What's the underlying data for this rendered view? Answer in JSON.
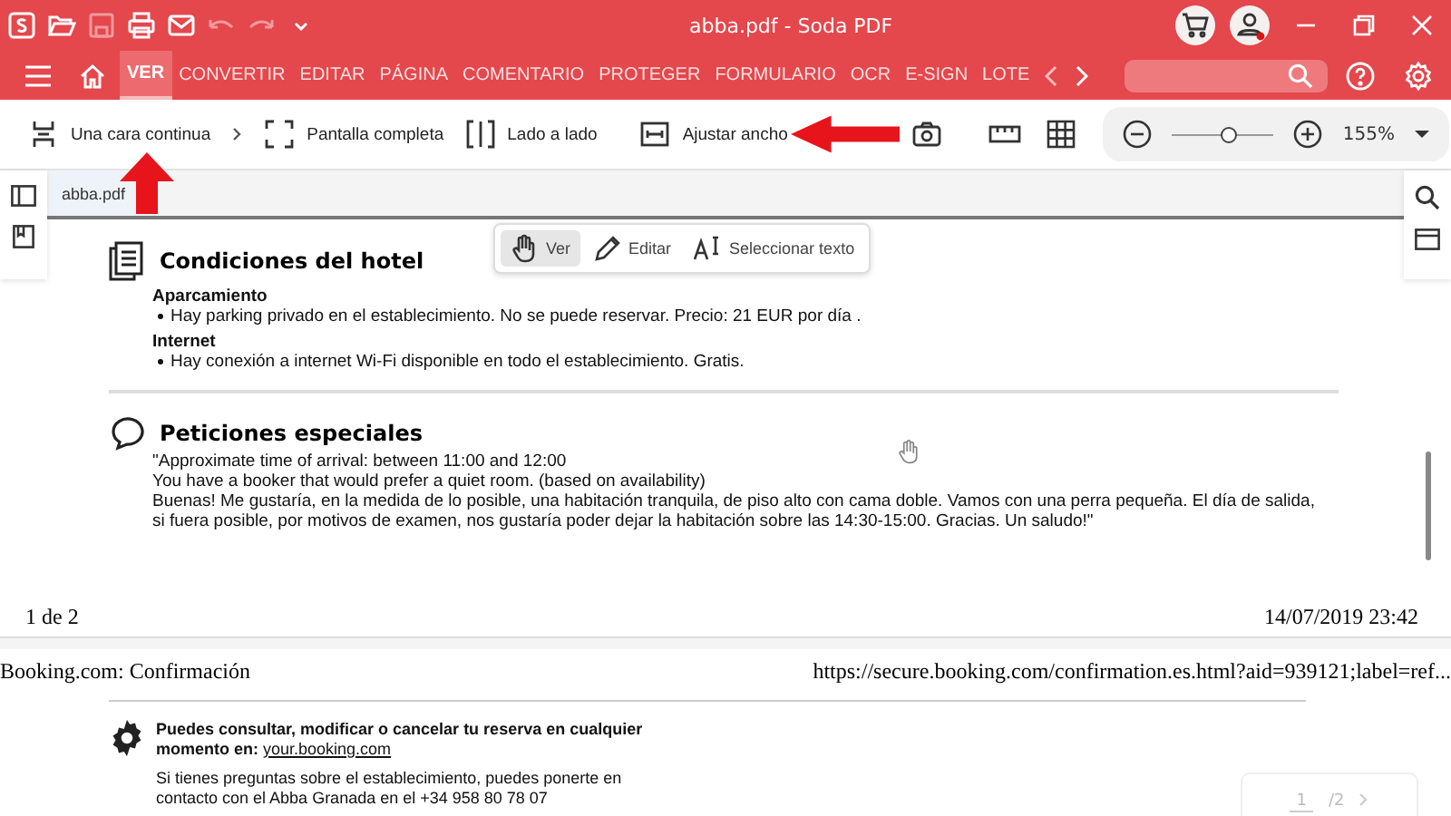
{
  "window": {
    "title": "abba.pdf  -  Soda PDF"
  },
  "quick_access": [
    {
      "kind": "logo",
      "disabled": false
    },
    {
      "kind": "open",
      "disabled": false
    },
    {
      "kind": "save",
      "disabled": true
    },
    {
      "kind": "print",
      "disabled": false
    },
    {
      "kind": "mail",
      "disabled": false
    },
    {
      "kind": "undo",
      "disabled": true
    },
    {
      "kind": "redo",
      "disabled": true
    },
    {
      "kind": "caret",
      "disabled": false
    }
  ],
  "menu_tabs": [
    {
      "label": "VER",
      "selected": true
    },
    {
      "label": "CONVERTIR",
      "selected": false
    },
    {
      "label": "EDITAR",
      "selected": false
    },
    {
      "label": "PÁGINA",
      "selected": false
    },
    {
      "label": "COMENTARIO",
      "selected": false
    },
    {
      "label": "PROTEGER",
      "selected": false
    },
    {
      "label": "FORMULARIO",
      "selected": false
    },
    {
      "label": "OCR",
      "selected": false
    },
    {
      "label": "E-SIGN",
      "selected": false
    },
    {
      "label": "LOTE",
      "selected": false
    }
  ],
  "toolbar": [
    {
      "kind": "continuous",
      "label": "Una cara continua"
    },
    {
      "kind": "fullscreen",
      "label": "Pantalla completa"
    },
    {
      "kind": "sidebyside",
      "label": "Lado a lado"
    },
    {
      "kind": "fitwidth",
      "label": "Ajustar ancho"
    }
  ],
  "zoom": {
    "level": 0.55,
    "reading": "155%"
  },
  "document_tab": {
    "label": "abba.pdf"
  },
  "view_modes": [
    {
      "kind": "hand",
      "label": "Ver",
      "selected": true
    },
    {
      "kind": "pen",
      "label": "Editar",
      "selected": false
    },
    {
      "kind": "text",
      "label": "Seleccionar texto",
      "selected": false
    }
  ],
  "page": {
    "sections": [
      {
        "kind": "doc",
        "title": "Condiciones del hotel",
        "items": [
          {
            "heading": "Aparcamiento",
            "bullets": [
              "Hay parking privado en el establecimiento. No se puede reservar. Precio: 21 EUR por día ."
            ]
          },
          {
            "heading": "Internet",
            "bullets": [
              "Hay conexión a internet Wi-Fi disponible en todo el establecimiento. Gratis."
            ]
          }
        ]
      },
      {
        "kind": "bubble",
        "title": "Peticiones especiales",
        "lines": [
          "\"Approximate time of arrival: between 11:00 and 12:00",
          "You have a booker that would prefer a quiet room. (based on availability)",
          "Buenas! Me gustaría, en la medida de lo posible, una habitación tranquila, de piso alto con cama doble. Vamos con una perra pequeña. El día de salida, si fuera posible, por motivos de examen, nos gustaría poder dejar la habitación sobre las 14:30-15:00. Gracias. Un saludo!\""
        ]
      }
    ],
    "footer_left": "1 de 2",
    "footer_right": "14/07/2019 23:42"
  },
  "page2": {
    "header_left": "Booking.com: Confirmación",
    "header_right": "https://secure.booking.com/confirmation.es.html?aid=939121;label=ref...",
    "notice_bold": "Puedes consultar, modificar o cancelar tu reserva en cualquier momento en:",
    "notice_link": "your.booking.com",
    "notice_text": "Si tienes preguntas sobre el establecimiento, puedes ponerte en contacto con el Abba Granada en el +34 958 80 78 07"
  },
  "page_nav": {
    "current": "1",
    "total": "/2"
  }
}
